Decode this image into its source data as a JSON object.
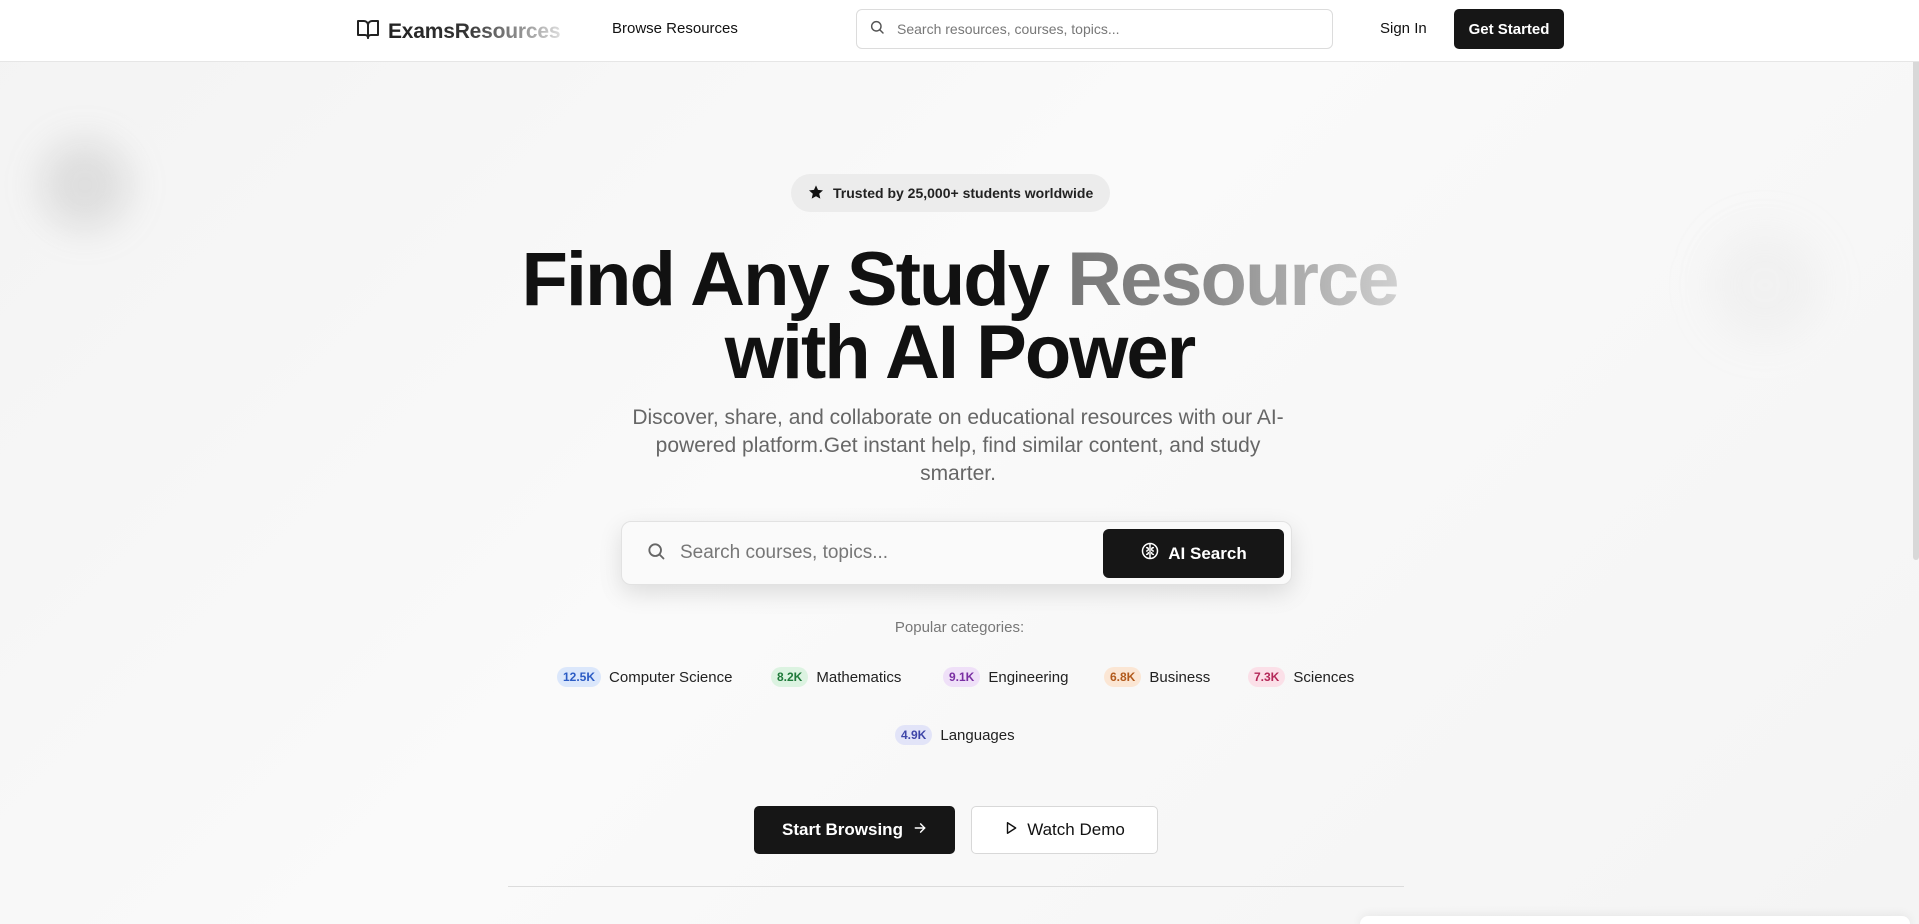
{
  "header": {
    "brand": "ExamsResources",
    "nav_browse": "Browse Resources",
    "search_placeholder": "Search resources, courses, topics...",
    "sign_in": "Sign In",
    "get_started": "Get Started"
  },
  "hero": {
    "trust_badge": "Trusted by 25,000+ students worldwide",
    "title_line1_a": "Find Any Study ",
    "title_line1_b": "Resource",
    "title_line2": "with AI Power",
    "subtitle": "Discover, share, and collaborate on educational resources with our AI-powered platform.Get instant help, find similar content, and study smarter.",
    "search_placeholder": "Search courses, topics...",
    "ai_search_label": "AI Search",
    "popular_label": "Popular categories:",
    "categories": [
      {
        "count": "12.5K",
        "label": "Computer Science",
        "bg": "#dbe7fb",
        "fg": "#2c5cc5"
      },
      {
        "count": "8.2K",
        "label": "Mathematics",
        "bg": "#dcf3e1",
        "fg": "#1f7a3a"
      },
      {
        "count": "9.1K",
        "label": "Engineering",
        "bg": "#efe0f8",
        "fg": "#7a2fa3"
      },
      {
        "count": "6.8K",
        "label": "Business",
        "bg": "#fbe6d4",
        "fg": "#b25a1b"
      },
      {
        "count": "7.3K",
        "label": "Sciences",
        "bg": "#fbe0e8",
        "fg": "#b42858"
      },
      {
        "count": "4.9K",
        "label": "Languages",
        "bg": "#e2e4f8",
        "fg": "#3f46a8"
      }
    ],
    "start_browsing": "Start Browsing",
    "watch_demo": "Watch Demo"
  },
  "colors": {
    "primary": "#161616",
    "background": "#f4f4f4"
  }
}
